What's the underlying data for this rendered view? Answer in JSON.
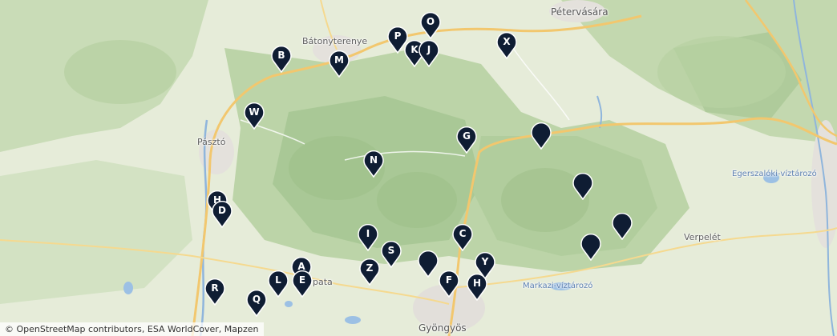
{
  "map": {
    "places": [
      {
        "name": "Pétervására",
        "cls": "big"
      },
      {
        "name": "Bátonyterenye",
        "cls": ""
      },
      {
        "name": "Pásztó",
        "cls": ""
      },
      {
        "name": "Egerszalóki-víztározó",
        "cls": "water"
      },
      {
        "name": "Verpelét",
        "cls": ""
      },
      {
        "name": "Markazi-víztározó",
        "cls": "water"
      },
      {
        "name": "pata",
        "cls": ""
      },
      {
        "name": "Gyöngyös",
        "cls": "big"
      }
    ],
    "markers": [
      {
        "label": "O"
      },
      {
        "label": "P"
      },
      {
        "label": "K"
      },
      {
        "label": "J"
      },
      {
        "label": "X"
      },
      {
        "label": "B"
      },
      {
        "label": "M"
      },
      {
        "label": "W"
      },
      {
        "label": "G"
      },
      {
        "label": ""
      },
      {
        "label": "N"
      },
      {
        "label": ""
      },
      {
        "label": "H"
      },
      {
        "label": "D"
      },
      {
        "label": ""
      },
      {
        "label": "I"
      },
      {
        "label": "C"
      },
      {
        "label": "S"
      },
      {
        "label": ""
      },
      {
        "label": "A"
      },
      {
        "label": "Z"
      },
      {
        "label": "Y"
      },
      {
        "label": ""
      },
      {
        "label": "L"
      },
      {
        "label": "E"
      },
      {
        "label": "F"
      },
      {
        "label": "H"
      },
      {
        "label": "R"
      },
      {
        "label": "Q"
      }
    ],
    "attribution": "© OpenStreetMap contributors, ESA WorldCover, Mapzen"
  }
}
